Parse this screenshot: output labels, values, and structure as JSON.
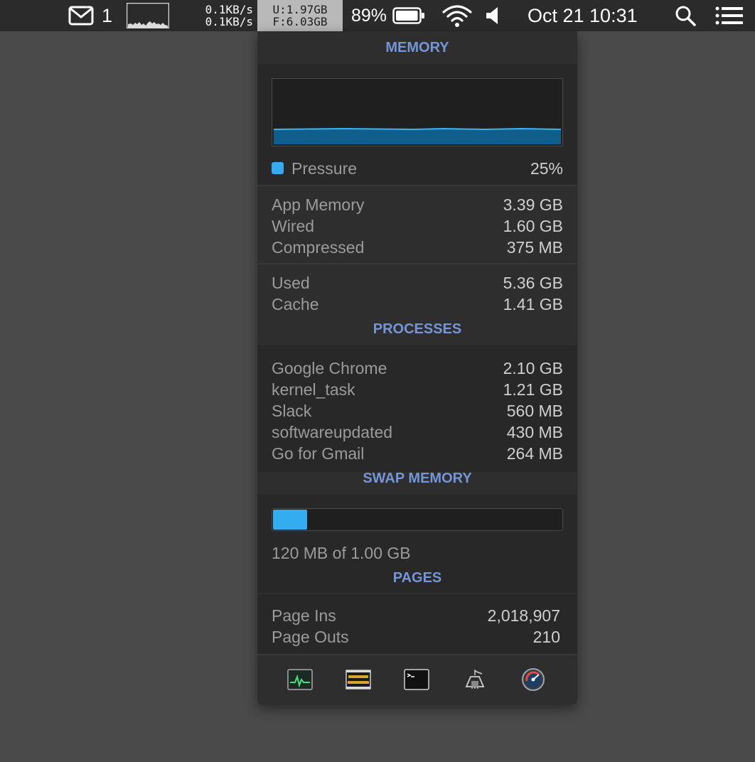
{
  "menubar": {
    "mail_count": "1",
    "net_up": "0.1KB/s",
    "net_down": "0.1KB/s",
    "mem_used_label": "U:",
    "mem_used_value": "1.97GB",
    "mem_free_label": "F:",
    "mem_free_value": "6.03GB",
    "battery_percent": "89%",
    "battery_level": 0.89,
    "datetime": "Oct 21 10:31",
    "icons": [
      "mail-icon",
      "network-graph",
      "battery-icon",
      "wifi-icon",
      "volume-icon",
      "search-icon",
      "list-icon"
    ]
  },
  "panel": {
    "memory_title": "MEMORY",
    "pressure_label": "Pressure",
    "pressure_value": "25%",
    "pressure_color": "#37aaf0",
    "breakdown": [
      {
        "label": "App Memory",
        "value": "3.39 GB"
      },
      {
        "label": "Wired",
        "value": "1.60 GB"
      },
      {
        "label": "Compressed",
        "value": "375 MB"
      }
    ],
    "totals": [
      {
        "label": "Used",
        "value": "5.36 GB"
      },
      {
        "label": "Cache",
        "value": "1.41 GB"
      }
    ],
    "processes_title": "PROCESSES",
    "processes": [
      {
        "label": "Google Chrome",
        "value": "2.10 GB"
      },
      {
        "label": "kernel_task",
        "value": "1.21 GB"
      },
      {
        "label": "Slack",
        "value": "560 MB"
      },
      {
        "label": "softwareupdated",
        "value": "430 MB"
      },
      {
        "label": "Go for Gmail",
        "value": "264 MB"
      }
    ],
    "swap_title": "SWAP MEMORY",
    "swap_text": "120 MB of 1.00 GB",
    "swap_fraction": 0.117,
    "pages_title": "PAGES",
    "pages": [
      {
        "label": "Page Ins",
        "value": "2,018,907"
      },
      {
        "label": "Page Outs",
        "value": "210"
      }
    ],
    "toolbar": [
      "activity-monitor-icon",
      "console-icon",
      "terminal-icon",
      "system-information-icon",
      "disk-utility-icon"
    ],
    "accent_color": "#7496d6"
  }
}
